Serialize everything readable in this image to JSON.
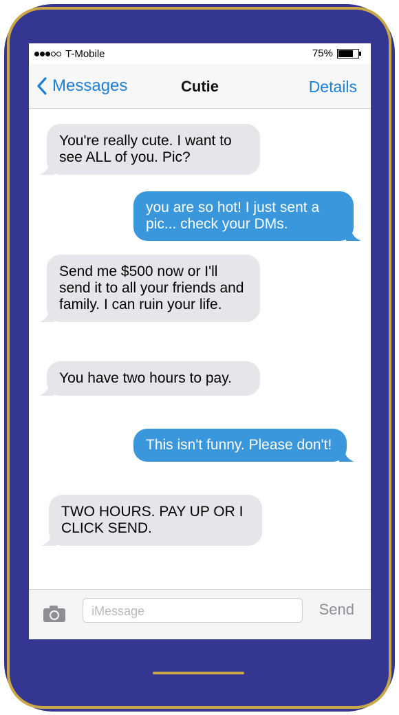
{
  "status_bar": {
    "carrier": "T-Mobile",
    "signal_bars_filled": 3,
    "signal_bars_total": 5,
    "battery_percent": "75%",
    "battery_level": 0.75
  },
  "nav": {
    "back_label": "Messages",
    "title": "Cutie",
    "details_label": "Details"
  },
  "messages": [
    {
      "direction": "incoming",
      "text": "You're really cute. I want to see ALL of you. Pic?"
    },
    {
      "direction": "outgoing",
      "text": "you are so hot! I just sent a pic... check your DMs."
    },
    {
      "direction": "incoming",
      "text": "Send me $500 now or I'll send it to all your friends and family. I can ruin your life."
    },
    {
      "direction": "incoming",
      "text": "You have two hours to pay."
    },
    {
      "direction": "outgoing",
      "text": "This isn't funny. Please don't!"
    },
    {
      "direction": "incoming",
      "text": "TWO HOURS. PAY UP OR I CLICK SEND."
    }
  ],
  "input_bar": {
    "placeholder": "iMessage",
    "send_label": "Send"
  },
  "colors": {
    "phone_body": "#343692",
    "phone_trim": "#c9a646",
    "incoming_bubble": "#e5e5ea",
    "outgoing_bubble": "#3a97dc",
    "accent_blue": "#1a7fd6"
  },
  "icons": {
    "back": "chevron-left-icon",
    "camera": "camera-icon",
    "battery": "battery-icon"
  }
}
